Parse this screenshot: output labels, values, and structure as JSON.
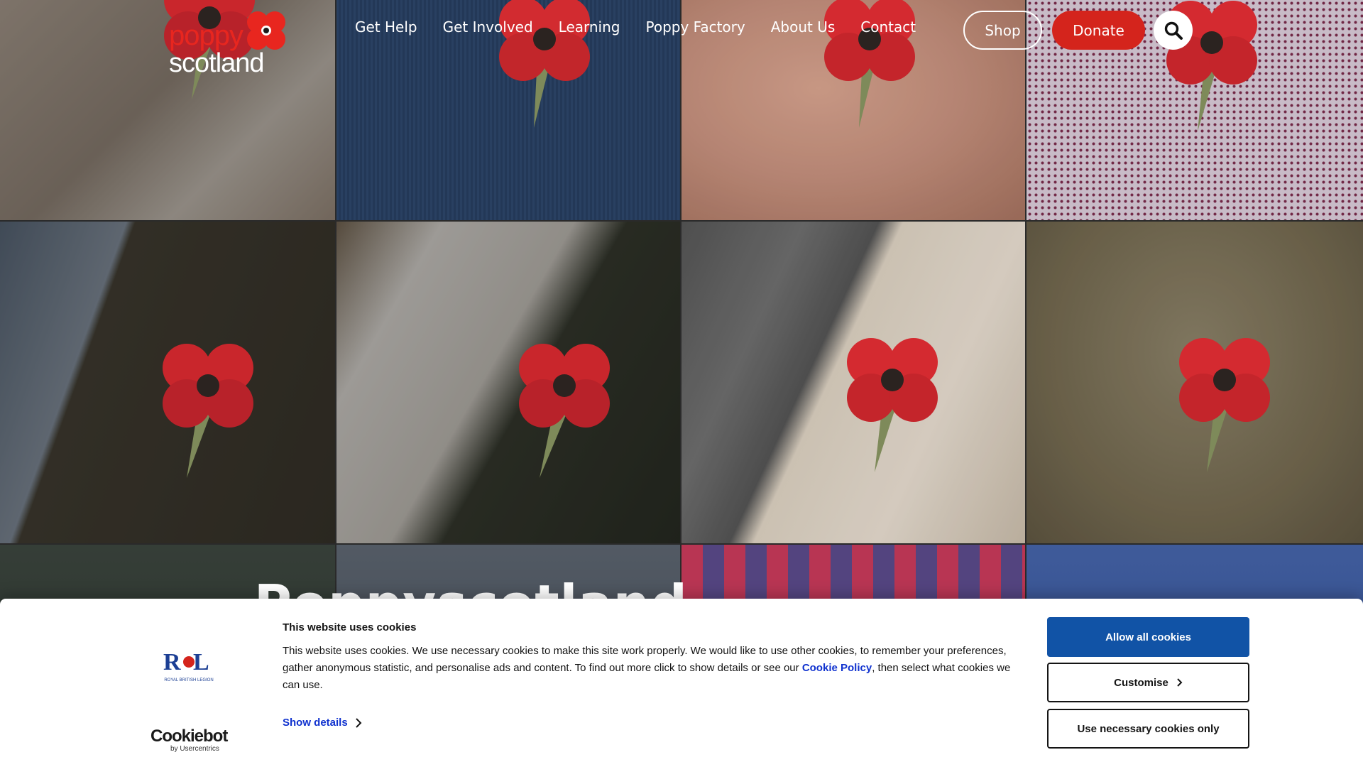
{
  "header": {
    "logo": {
      "line1": "poppy",
      "line2": "scotland"
    },
    "nav": [
      {
        "label": "Get Help"
      },
      {
        "label": "Get Involved"
      },
      {
        "label": "Learning"
      },
      {
        "label": "Poppy Factory"
      },
      {
        "label": "About Us"
      },
      {
        "label": "Contact"
      }
    ],
    "shop_label": "Shop",
    "donate_label": "Donate",
    "search_icon": "search-icon"
  },
  "hero": {
    "title": "Poppyscotland"
  },
  "cookie_banner": {
    "title": "This website uses cookies",
    "body_before_link": "This website uses cookies. We use necessary cookies to make this site work properly. We would like to use other cookies, to remember your preferences, gather anonymous statistic, and personalise ads and content. To find out more click to show details or see our ",
    "link_text": "Cookie Policy",
    "body_after_link": ", then select what cookies we can use.",
    "show_details_label": "Show details",
    "allow_all_label": "Allow all cookies",
    "customise_label": "Customise",
    "necessary_only_label": "Use necessary cookies only",
    "rbl_logo_text": "ROYAL BRITISH LEGION",
    "cookiebot_label": "Cookiebot",
    "cookiebot_sub": "by Usercentrics"
  },
  "colors": {
    "brand_red": "#d4241c",
    "cookie_blue": "#1153a6",
    "link_blue": "#1032cf"
  }
}
